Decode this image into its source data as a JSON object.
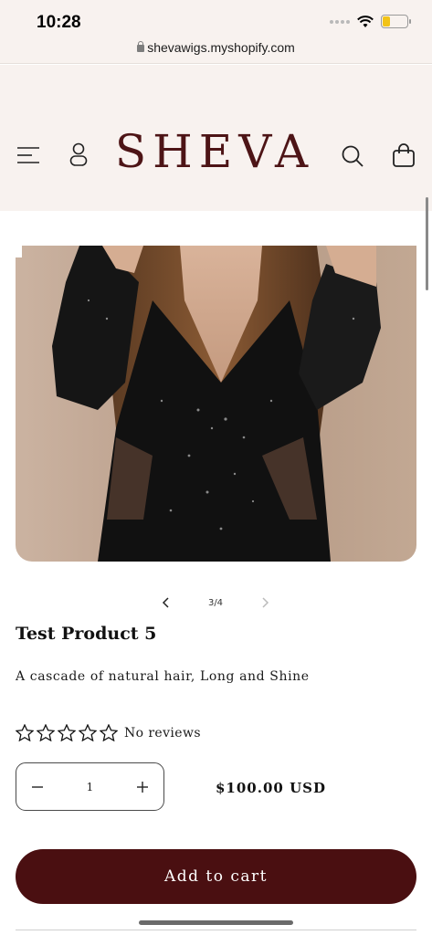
{
  "status_bar": {
    "time": "10:28",
    "url": "shevawigs.myshopify.com"
  },
  "header": {
    "logo": "SHEVA",
    "logo_color": "#4d1416",
    "menu_icon": "menu-icon",
    "account_icon": "account-icon",
    "search_icon": "search-icon",
    "cart_icon": "cart-icon"
  },
  "gallery": {
    "counter": "3/4",
    "prev_icon": "chevron-left-icon",
    "next_icon": "chevron-right-icon"
  },
  "product": {
    "title": "Test Product 5",
    "description": "A cascade of natural hair, Long and Shine",
    "rating_stars": 0,
    "rating_max": 5,
    "reviews_label": "No reviews",
    "quantity": "1",
    "price": "$100.00 USD"
  },
  "actions": {
    "add_to_cart": "Add to cart",
    "button_color": "#4a0f11"
  }
}
